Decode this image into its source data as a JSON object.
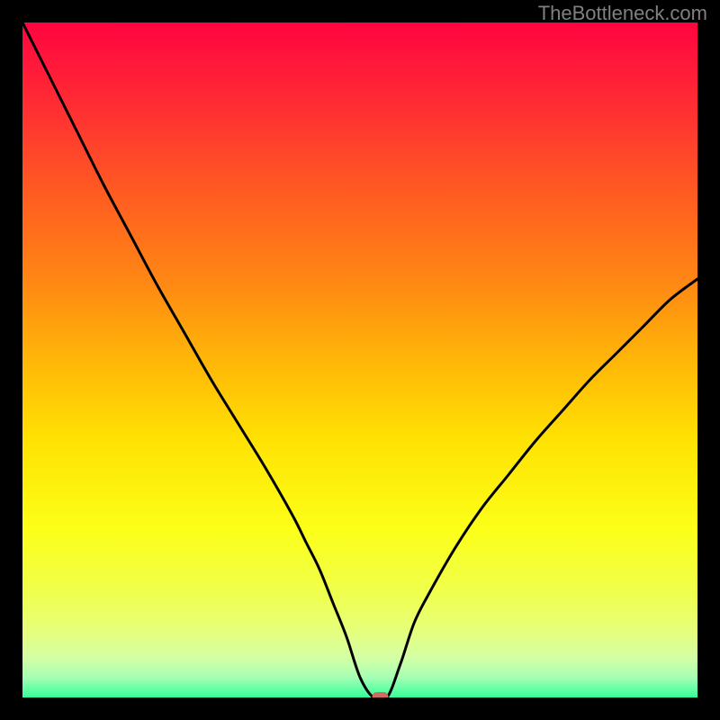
{
  "watermark": "TheBottleneck.com",
  "chart_data": {
    "type": "line",
    "title": "",
    "xlabel": "",
    "ylabel": "",
    "xlim": [
      0,
      100
    ],
    "ylim": [
      0,
      100
    ],
    "x": [
      0,
      4,
      8,
      12,
      16,
      20,
      24,
      28,
      32,
      36,
      40,
      42,
      44,
      46,
      48,
      50,
      52,
      54,
      56,
      58,
      60,
      64,
      68,
      72,
      76,
      80,
      84,
      88,
      92,
      96,
      100
    ],
    "values": [
      100,
      92,
      84,
      76,
      68.5,
      61,
      54,
      47,
      40.5,
      34,
      27,
      23,
      19,
      14,
      9,
      3,
      0,
      0,
      5,
      11,
      15,
      22,
      28,
      33,
      38,
      42.5,
      47,
      51,
      55,
      59,
      62
    ],
    "marker": {
      "x": 53,
      "y": 0,
      "color": "#d26a63"
    },
    "background_gradient": {
      "stops": [
        {
          "offset": 0.0,
          "color": "#ff0440"
        },
        {
          "offset": 0.12,
          "color": "#ff2c34"
        },
        {
          "offset": 0.25,
          "color": "#ff5a22"
        },
        {
          "offset": 0.38,
          "color": "#ff8614"
        },
        {
          "offset": 0.5,
          "color": "#ffb608"
        },
        {
          "offset": 0.62,
          "color": "#ffe203"
        },
        {
          "offset": 0.75,
          "color": "#fcff18"
        },
        {
          "offset": 0.84,
          "color": "#f0ff4a"
        },
        {
          "offset": 0.9,
          "color": "#e6ff7a"
        },
        {
          "offset": 0.94,
          "color": "#d5ffa4"
        },
        {
          "offset": 0.97,
          "color": "#a6ffb4"
        },
        {
          "offset": 1.0,
          "color": "#35ff9a"
        }
      ]
    }
  }
}
